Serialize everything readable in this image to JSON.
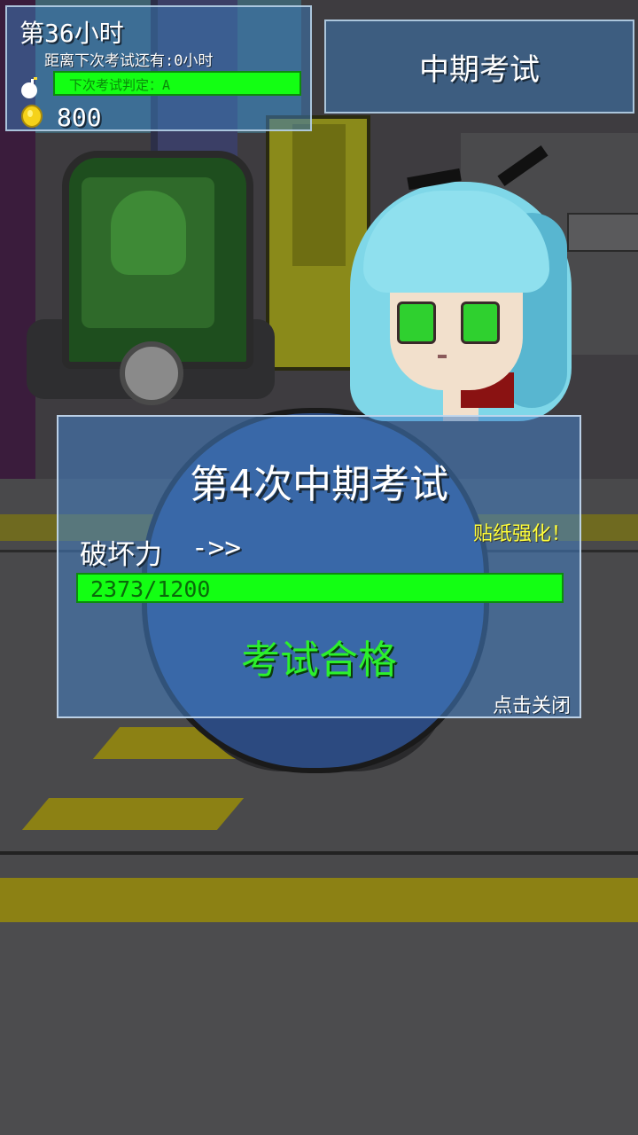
{
  "hud": {
    "hour_label": "第36小时",
    "next_exam_label": "距离下次考试还有:0小时",
    "grade_label": "下次考试判定：A",
    "coin_count": "800",
    "bomb_icon": "bomb-icon",
    "coin_icon": "coin-icon"
  },
  "top_button": {
    "label": "中期考试"
  },
  "dialog": {
    "title": "第4次中期考试",
    "sticker_label": "贴纸强化！",
    "power_label": "破坏力",
    "power_arrow": "->>",
    "power_value": "2373/1200",
    "power_fill_fraction": 1.0,
    "result": "考试合格",
    "close_hint": "点击关闭"
  },
  "colors": {
    "bar_green": "#13ff13",
    "result_green": "#2cf02c",
    "sticker_yellow": "#ffff3a",
    "panel_blue": "#3c78b4"
  }
}
